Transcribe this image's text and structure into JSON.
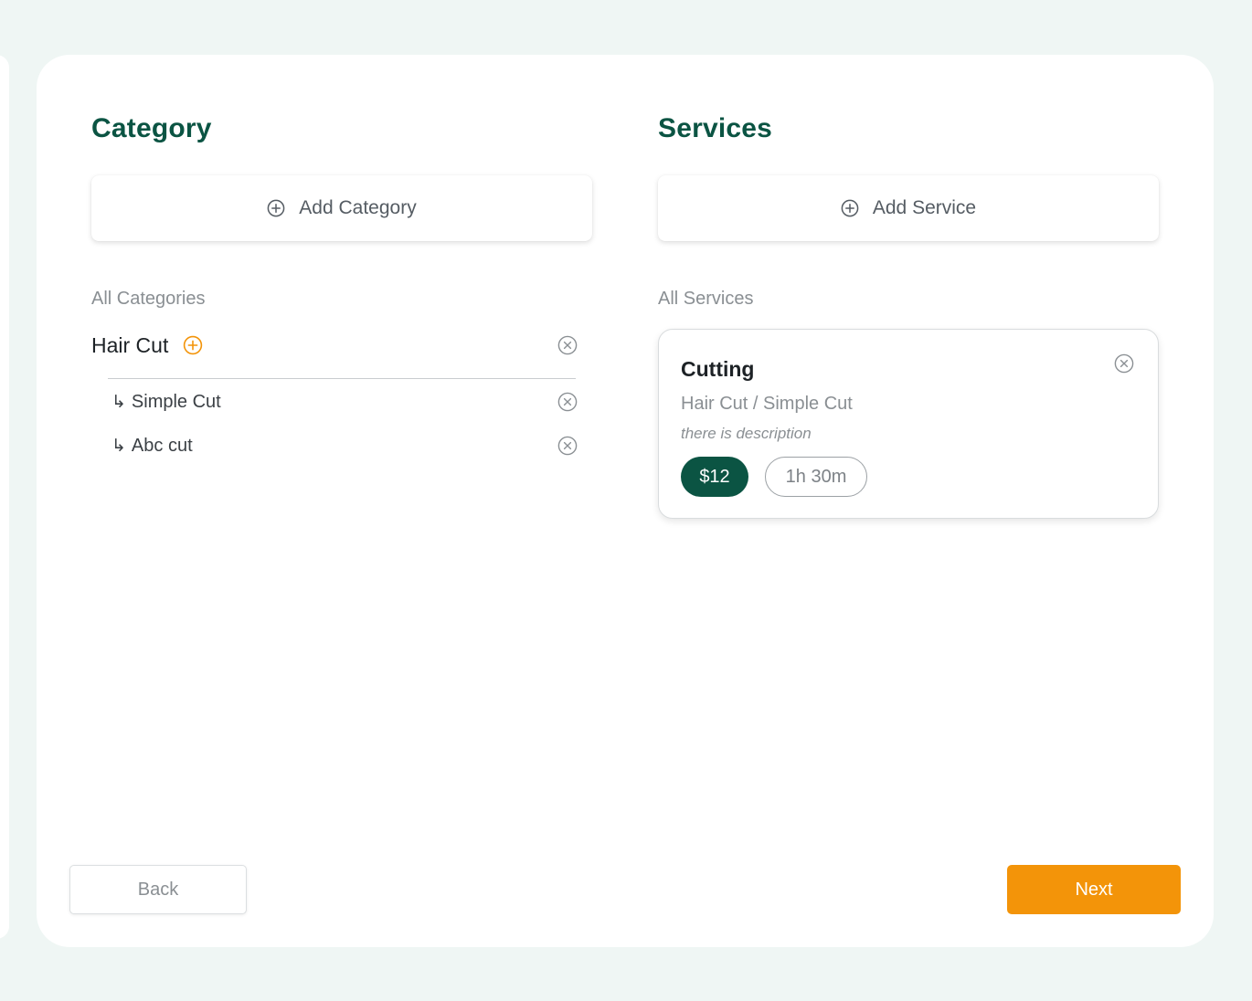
{
  "colors": {
    "brand_green": "#0b5443",
    "accent_orange": "#f39409",
    "background": "#eff6f4",
    "muted_text": "#8a8f93"
  },
  "category": {
    "title": "Category",
    "add_label": "Add Category",
    "add_icon": "plus-circle-icon",
    "list_label": "All Categories",
    "items": [
      {
        "name": "Hair Cut",
        "add_sub_icon": "plus-circle-icon",
        "remove_icon": "close-circle-icon",
        "subcategories": [
          {
            "arrow": "↳",
            "name": "Simple Cut",
            "remove_icon": "close-circle-icon"
          },
          {
            "arrow": "↳",
            "name": "Abc cut",
            "remove_icon": "close-circle-icon"
          }
        ]
      }
    ]
  },
  "services": {
    "title": "Services",
    "add_label": "Add Service",
    "add_icon": "plus-circle-icon",
    "list_label": "All Services",
    "items": [
      {
        "name": "Cutting",
        "path": "Hair Cut / Simple Cut",
        "description": "there is description",
        "price": "$12",
        "duration": "1h 30m",
        "remove_icon": "close-circle-icon"
      }
    ]
  },
  "footer": {
    "back_label": "Back",
    "next_label": "Next"
  }
}
